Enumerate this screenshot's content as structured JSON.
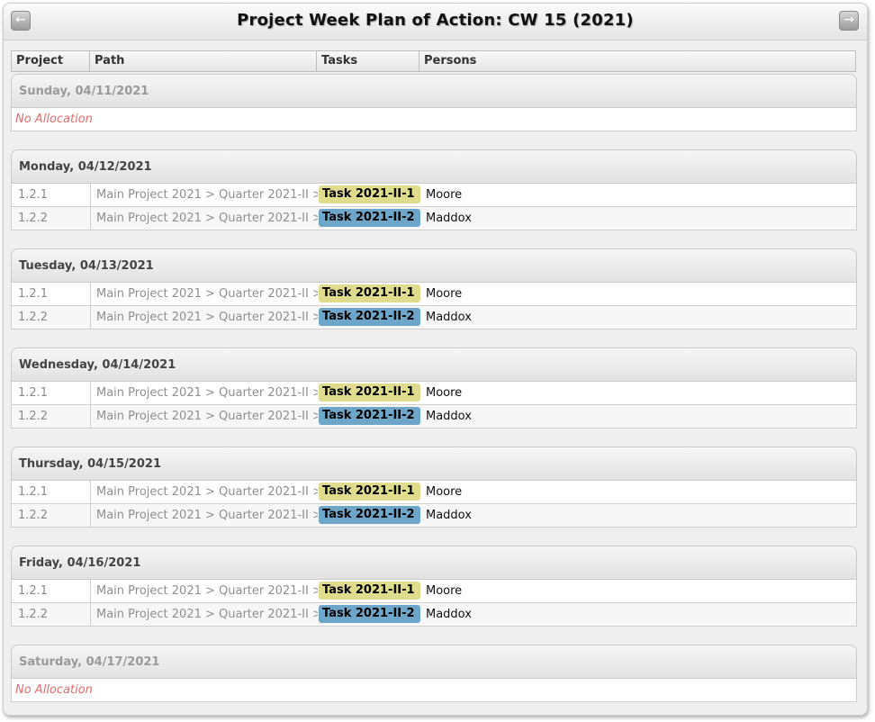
{
  "header": {
    "title": "Project Week Plan of Action:  CW 15 (2021)",
    "prev_icon": "arrow-left-icon",
    "next_icon": "arrow-right-icon"
  },
  "columns": [
    "Project No.",
    "Path",
    "Tasks",
    "Persons"
  ],
  "days": [
    {
      "label": "Sunday, 04/11/2021",
      "empty_text": "No Allocation",
      "rows": []
    },
    {
      "label": "Monday, 04/12/2021",
      "rows": [
        {
          "no": "1.2.1",
          "path": "Main Project 2021 > Quarter 2021-II >",
          "task": "Task 2021-II-1",
          "task_color": "#e0dc8d",
          "person": "Moore"
        },
        {
          "no": "1.2.2",
          "path": "Main Project 2021 > Quarter 2021-II >",
          "task": "Task 2021-II-2",
          "task_color": "#6ea6c9",
          "person": "Maddox"
        }
      ]
    },
    {
      "label": "Tuesday, 04/13/2021",
      "rows": [
        {
          "no": "1.2.1",
          "path": "Main Project 2021 > Quarter 2021-II >",
          "task": "Task 2021-II-1",
          "task_color": "#e0dc8d",
          "person": "Moore"
        },
        {
          "no": "1.2.2",
          "path": "Main Project 2021 > Quarter 2021-II >",
          "task": "Task 2021-II-2",
          "task_color": "#6ea6c9",
          "person": "Maddox"
        }
      ]
    },
    {
      "label": "Wednesday, 04/14/2021",
      "rows": [
        {
          "no": "1.2.1",
          "path": "Main Project 2021 > Quarter 2021-II >",
          "task": "Task 2021-II-1",
          "task_color": "#e0dc8d",
          "person": "Moore"
        },
        {
          "no": "1.2.2",
          "path": "Main Project 2021 > Quarter 2021-II >",
          "task": "Task 2021-II-2",
          "task_color": "#6ea6c9",
          "person": "Maddox"
        }
      ]
    },
    {
      "label": "Thursday, 04/15/2021",
      "rows": [
        {
          "no": "1.2.1",
          "path": "Main Project 2021 > Quarter 2021-II >",
          "task": "Task 2021-II-1",
          "task_color": "#e0dc8d",
          "person": "Moore"
        },
        {
          "no": "1.2.2",
          "path": "Main Project 2021 > Quarter 2021-II >",
          "task": "Task 2021-II-2",
          "task_color": "#6ea6c9",
          "person": "Maddox"
        }
      ]
    },
    {
      "label": "Friday, 04/16/2021",
      "rows": [
        {
          "no": "1.2.1",
          "path": "Main Project 2021 > Quarter 2021-II >",
          "task": "Task 2021-II-1",
          "task_color": "#e0dc8d",
          "person": "Moore"
        },
        {
          "no": "1.2.2",
          "path": "Main Project 2021 > Quarter 2021-II >",
          "task": "Task 2021-II-2",
          "task_color": "#6ea6c9",
          "person": "Maddox"
        }
      ]
    },
    {
      "label": "Saturday, 04/17/2021",
      "empty_text": "No Allocation",
      "rows": []
    }
  ]
}
